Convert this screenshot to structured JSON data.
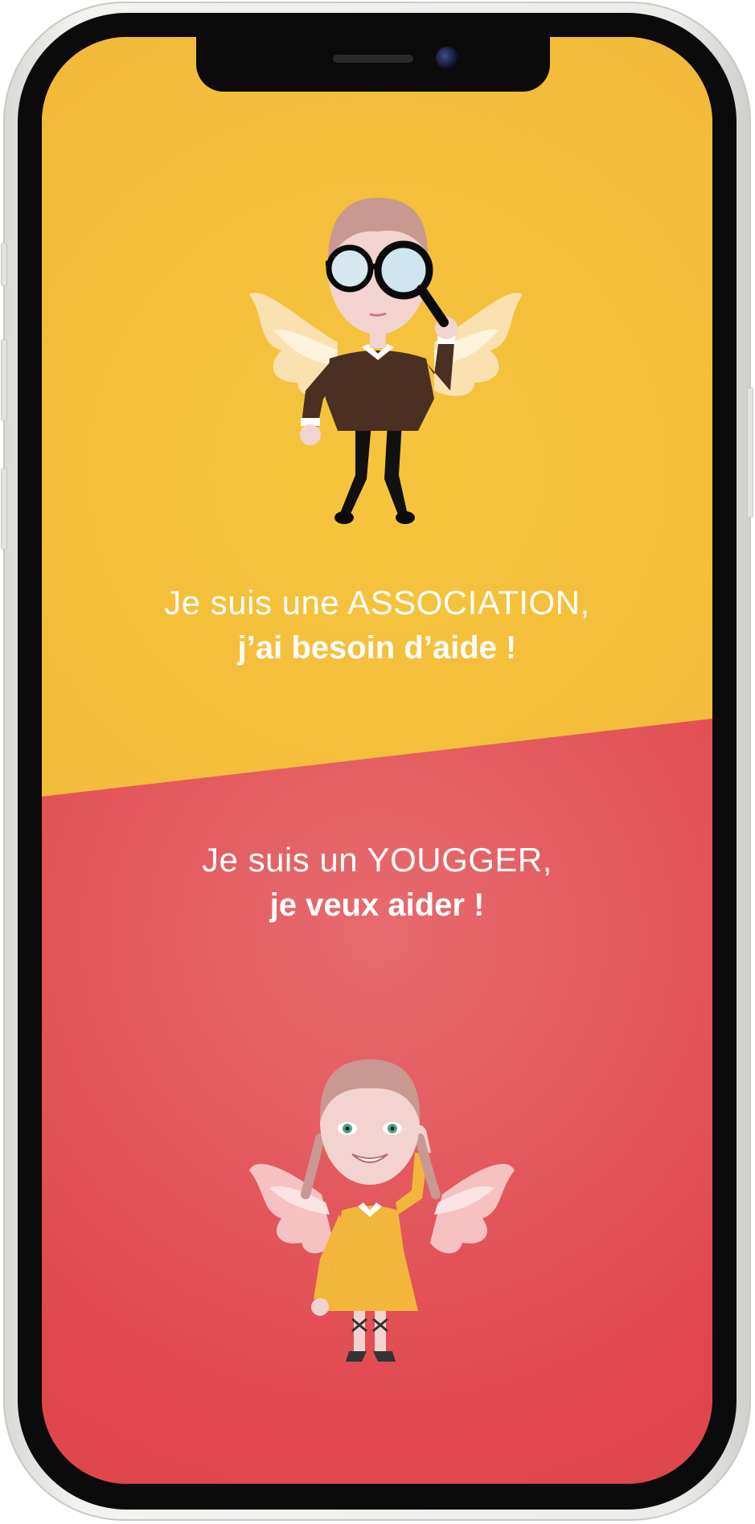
{
  "association": {
    "title": "Je suis une ASSOCIATION,",
    "subtitle": "j’ai besoin d’aide !"
  },
  "yougger": {
    "title": "Je suis un YOUGGER,",
    "subtitle": "je veux aider !"
  },
  "colors": {
    "association_bg": "#f2b73a",
    "yougger_bg": "#e0474c",
    "text": "#ffffff"
  }
}
